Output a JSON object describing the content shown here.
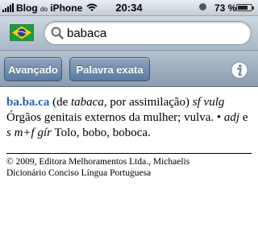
{
  "status_bar": {
    "carrier": "Blog",
    "carrier_small": "do",
    "device": "iPhone",
    "time": "20:34",
    "battery_percent": "73 %",
    "battery_level": 0.73,
    "icons": [
      "signal-bars-icon",
      "wifi-icon",
      "rotation-lock-icon",
      "battery-icon"
    ]
  },
  "search": {
    "flag_icon": "brazil-flag-icon",
    "query": "babaca",
    "accent": "#1f63b0"
  },
  "toolbar": {
    "advanced_label": "Avançado",
    "exact_word_label": "Palavra exata",
    "info_icon": "info-icon"
  },
  "entry": {
    "headword": "ba.ba.ca",
    "p1": " (de ",
    "etym_word": "tabaca",
    "p2": ", por assimilação) ",
    "gram1": "sf vulg",
    "def1": " Órgãos genitais externos da mulher; vulva. • ",
    "gram2a": "adj",
    "p3": " e ",
    "gram2b": "s m+f gír",
    "def2": " Tolo, bobo, boboca."
  },
  "copyright": {
    "line1": "© 2009, Editora Melhoramentos Ltda., Michaelis",
    "line2": "Dicionário Conciso Língua Portuguesa"
  }
}
